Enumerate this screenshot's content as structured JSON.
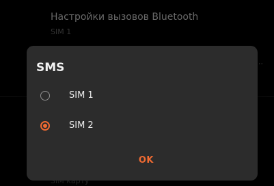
{
  "background": {
    "item_title": "Настройки вызовов Bluetooth",
    "item_subtitle": "SIM 1",
    "truncated_text": "..",
    "bottom_partial": "SIM карту"
  },
  "dialog": {
    "title": "SMS",
    "options": [
      {
        "label": "SIM 1",
        "selected": false
      },
      {
        "label": "SIM 2",
        "selected": true
      }
    ],
    "ok_label": "OK"
  },
  "colors": {
    "accent": "#ef6a32",
    "dialog_bg": "#2c2c2c",
    "background": "#000000"
  }
}
